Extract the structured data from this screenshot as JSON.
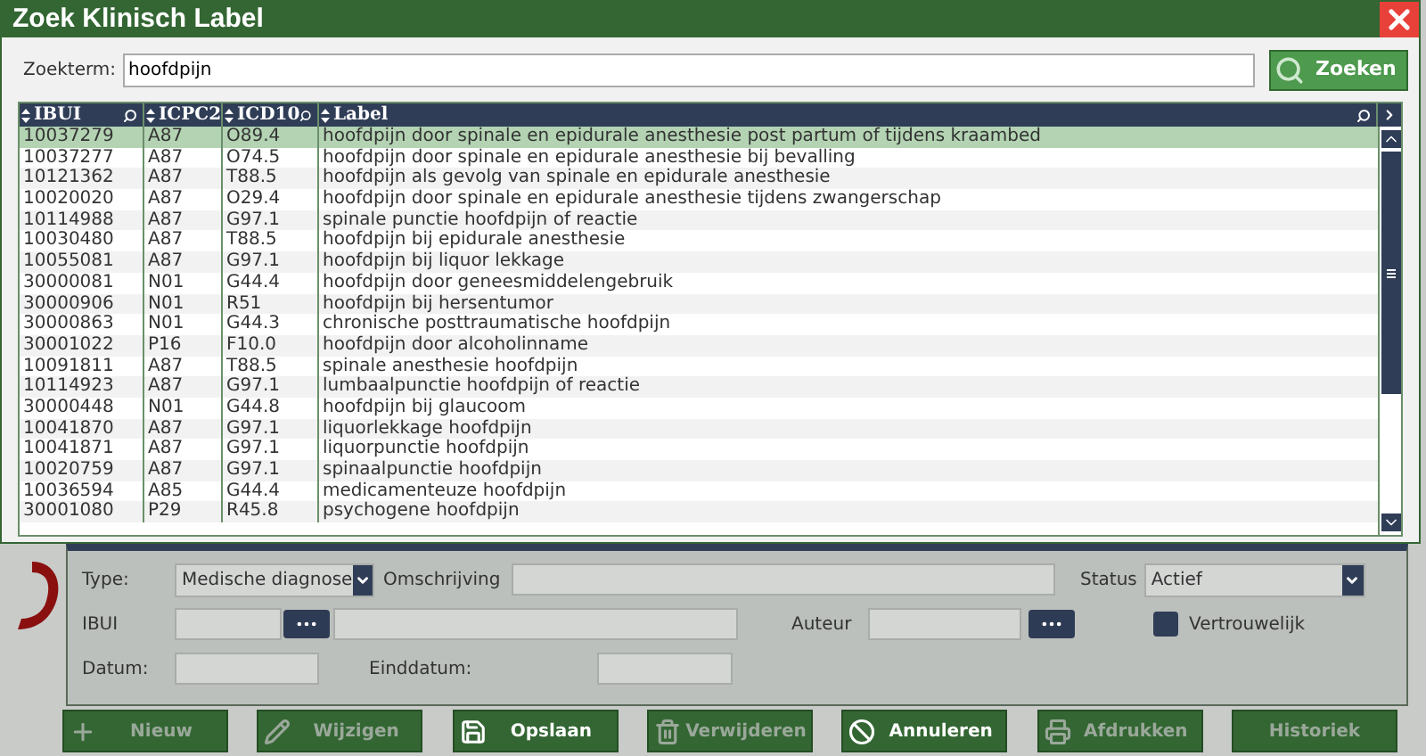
{
  "dialog": {
    "title": "Zoek Klinisch Label",
    "search": {
      "label": "Zoekterm:",
      "value": "hoofdpijn"
    },
    "search_button": "Zoeken",
    "table": {
      "columns": [
        "IBUI",
        "ICPC2",
        "ICD10",
        "Label"
      ],
      "rows": [
        {
          "cells": [
            "10037279",
            "A87",
            "O89.4",
            "hoofdpijn door spinale en epidurale anesthesie post partum of tijdens kraambed"
          ],
          "selected": true
        },
        {
          "cells": [
            "10037277",
            "A87",
            "O74.5",
            "hoofdpijn door spinale en epidurale anesthesie bij bevalling"
          ],
          "selected": false
        },
        {
          "cells": [
            "10121362",
            "A87",
            "T88.5",
            "hoofdpijn als gevolg van spinale en epidurale anesthesie"
          ],
          "selected": false
        },
        {
          "cells": [
            "10020020",
            "A87",
            "O29.4",
            "hoofdpijn door spinale en epidurale anesthesie tijdens zwangerschap"
          ],
          "selected": false
        },
        {
          "cells": [
            "10114988",
            "A87",
            "G97.1",
            "spinale punctie hoofdpijn of reactie"
          ],
          "selected": false
        },
        {
          "cells": [
            "10030480",
            "A87",
            "T88.5",
            "hoofdpijn bij epidurale anesthesie"
          ],
          "selected": false
        },
        {
          "cells": [
            "10055081",
            "A87",
            "G97.1",
            "hoofdpijn bij liquor lekkage"
          ],
          "selected": false
        },
        {
          "cells": [
            "30000081",
            "N01",
            "G44.4",
            "hoofdpijn door geneesmiddelengebruik"
          ],
          "selected": false
        },
        {
          "cells": [
            "30000906",
            "N01",
            "R51",
            "hoofdpijn bij hersentumor"
          ],
          "selected": false
        },
        {
          "cells": [
            "30000863",
            "N01",
            "G44.3",
            "chronische posttraumatische hoofdpijn"
          ],
          "selected": false
        },
        {
          "cells": [
            "30001022",
            "P16",
            "F10.0",
            "hoofdpijn door alcoholinname"
          ],
          "selected": false
        },
        {
          "cells": [
            "10091811",
            "A87",
            "T88.5",
            "spinale anesthesie hoofdpijn"
          ],
          "selected": false
        },
        {
          "cells": [
            "10114923",
            "A87",
            "G97.1",
            "lumbaalpunctie hoofdpijn of reactie"
          ],
          "selected": false
        },
        {
          "cells": [
            "30000448",
            "N01",
            "G44.8",
            "hoofdpijn bij glaucoom"
          ],
          "selected": false
        },
        {
          "cells": [
            "10041870",
            "A87",
            "G97.1",
            "liquorlekkage hoofdpijn"
          ],
          "selected": false
        },
        {
          "cells": [
            "10041871",
            "A87",
            "G97.1",
            "liquorpunctie hoofdpijn"
          ],
          "selected": false
        },
        {
          "cells": [
            "10020759",
            "A87",
            "G97.1",
            "spinaalpunctie hoofdpijn"
          ],
          "selected": false
        },
        {
          "cells": [
            "10036594",
            "A85",
            "G44.4",
            "medicamenteuze hoofdpijn"
          ],
          "selected": false
        },
        {
          "cells": [
            "30001080",
            "P29",
            "R45.8",
            "psychogene hoofdpijn"
          ],
          "selected": false
        }
      ]
    }
  },
  "form": {
    "type": {
      "label": "Type:",
      "value": "Medische diagnose"
    },
    "omschrijving": {
      "label": "Omschrijving"
    },
    "status": {
      "label": "Status",
      "value": "Actief"
    },
    "ibui": {
      "label": "IBUI"
    },
    "auteur": {
      "label": "Auteur"
    },
    "vertrouwelijk": {
      "label": "Vertrouwelijk",
      "checked": false
    },
    "datum": {
      "label": "Datum:"
    },
    "einddatum": {
      "label": "Einddatum:"
    }
  },
  "actions": [
    {
      "label": "Nieuw",
      "kind": "plus",
      "disabled": true
    },
    {
      "label": "Wijzigen",
      "kind": "pencil",
      "disabled": true
    },
    {
      "label": "Opslaan",
      "kind": "save",
      "disabled": false
    },
    {
      "label": "Verwijderen",
      "kind": "trash",
      "disabled": true
    },
    {
      "label": "Annuleren",
      "kind": "ban",
      "disabled": false
    },
    {
      "label": "Afdrukken",
      "kind": "printer",
      "disabled": true
    },
    {
      "label": "Historiek",
      "kind": "none",
      "disabled": true
    }
  ]
}
